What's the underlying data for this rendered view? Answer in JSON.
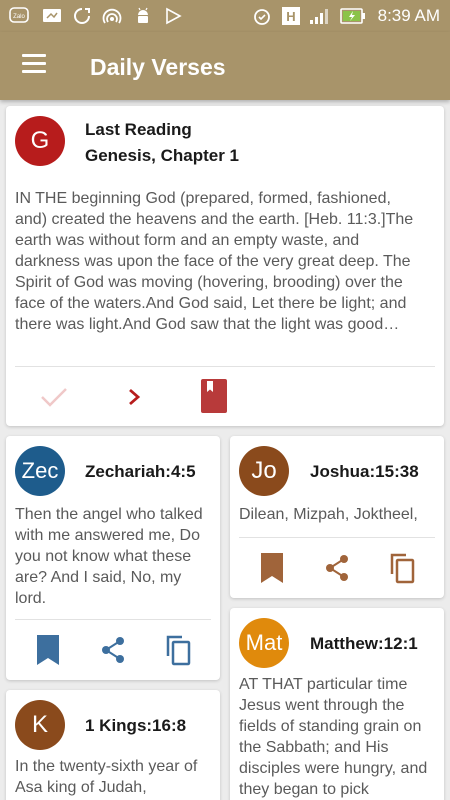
{
  "status_bar": {
    "time": "8:39 AM",
    "left_icons": [
      "zalo-icon",
      "screen-icon",
      "sync-icon",
      "hotspot-icon",
      "android-icon",
      "play-icon"
    ],
    "zalo_label": "Zalo",
    "network_label": "H"
  },
  "app_bar": {
    "title": "Daily Verses"
  },
  "last_reading": {
    "avatar_letter": "G",
    "avatar_color": "#b71c1c",
    "label": "Last Reading",
    "chapter": "Genesis, Chapter 1",
    "text": "IN THE beginning God (prepared, formed, fashioned, and) created the heavens and the earth. [Heb. 11:3.]The earth was without form and an empty waste, and darkness was upon the face of the very great deep. The Spirit of God was moving (hovering, brooding) over the face of the waters.And God said, Let there be light; and there was light.And God saw that the light was good…",
    "actions": [
      "check-icon",
      "chevron-right-icon",
      "book-icon"
    ]
  },
  "verses": [
    {
      "avatar": "Zec",
      "avatar_color": "#1e5c8c",
      "reference": "Zechariah:4:5",
      "text": "Then the angel who talked with me answered me, Do you not know what these are? And I said, No, my lord.",
      "action_color": "#3d6f9e"
    },
    {
      "avatar": "Jo",
      "avatar_color": "#8a4a1c",
      "reference": "Joshua:15:38",
      "text": "Dilean, Mizpah, Joktheel,",
      "action_color": "#a0643a"
    },
    {
      "avatar": "Mat",
      "avatar_color": "#e08a0c",
      "reference": "Matthew:12:1",
      "text": "AT THAT particular time Jesus went through the fields of standing grain on the Sabbath; and His disciples were hungry, and they began to pick"
    },
    {
      "avatar": "K",
      "avatar_color": "#8a4a1c",
      "reference": "1 Kings:16:8",
      "text": "In the twenty-sixth year of Asa king of Judah,"
    }
  ]
}
